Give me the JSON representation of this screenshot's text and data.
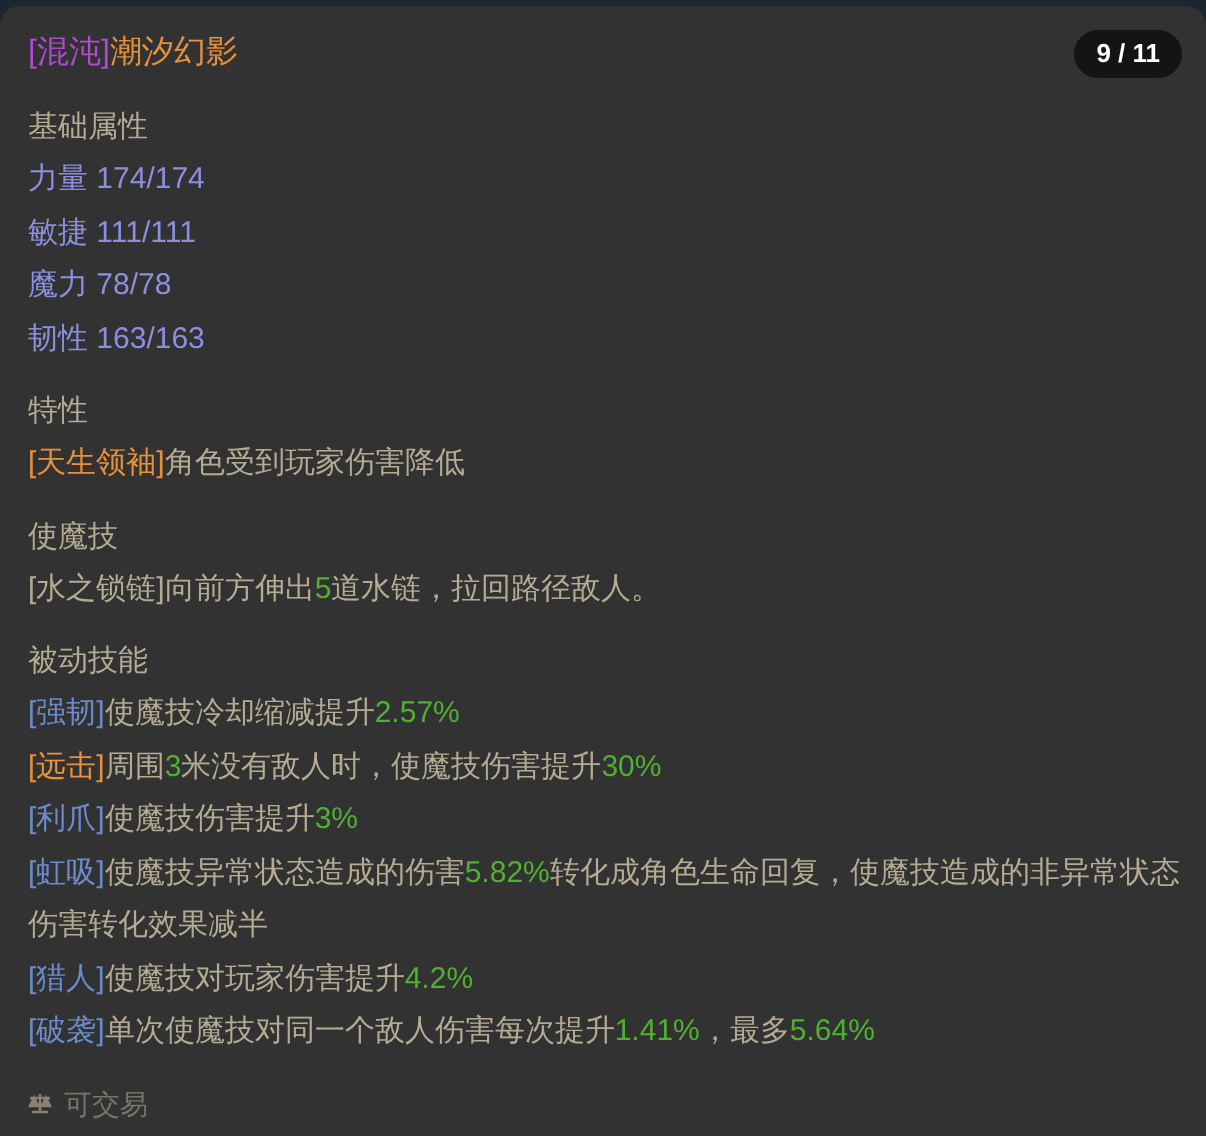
{
  "header": {
    "title": [
      {
        "kind": "chaos",
        "text": "[混沌]"
      },
      {
        "kind": "name",
        "text": "潮汐幻影"
      }
    ],
    "page": "9 / 11"
  },
  "sections": [
    {
      "heading": "基础属性",
      "lines": [
        [
          {
            "kind": "stat",
            "text": "力量 174/174"
          }
        ],
        [
          {
            "kind": "stat",
            "text": "敏捷 111/111"
          }
        ],
        [
          {
            "kind": "stat",
            "text": "魔力 78/78"
          }
        ],
        [
          {
            "kind": "stat",
            "text": "韧性 163/163"
          }
        ]
      ]
    },
    {
      "heading": "特性",
      "lines": [
        [
          {
            "kind": "gold_tag",
            "text": "[天生领袖]"
          },
          {
            "kind": "plain",
            "text": "角色受到玩家伤害降低"
          }
        ]
      ]
    },
    {
      "heading": "使魔技",
      "lines": [
        [
          {
            "kind": "plain",
            "text": "[水之锁链]向前方伸出"
          },
          {
            "kind": "number",
            "text": "5"
          },
          {
            "kind": "plain",
            "text": "道水链，拉回路径敌人。"
          }
        ]
      ]
    },
    {
      "heading": "被动技能",
      "lines": [
        [
          {
            "kind": "blue_tag",
            "text": "[强韧]"
          },
          {
            "kind": "plain",
            "text": "使魔技冷却缩减提升"
          },
          {
            "kind": "number",
            "text": "2.57%"
          }
        ],
        [
          {
            "kind": "gold_tag",
            "text": "[远击]"
          },
          {
            "kind": "plain",
            "text": "周围"
          },
          {
            "kind": "number",
            "text": "3"
          },
          {
            "kind": "plain",
            "text": "米没有敌人时，使魔技伤害提升"
          },
          {
            "kind": "number",
            "text": "30%"
          }
        ],
        [
          {
            "kind": "blue_tag",
            "text": "[利爪]"
          },
          {
            "kind": "plain",
            "text": "使魔技伤害提升"
          },
          {
            "kind": "number",
            "text": "3%"
          }
        ],
        [
          {
            "kind": "blue_tag",
            "text": "[虹吸]"
          },
          {
            "kind": "plain",
            "text": "使魔技异常状态造成的伤害"
          },
          {
            "kind": "number",
            "text": "5.82%"
          },
          {
            "kind": "plain",
            "text": "转化成角色生命回复，使魔技造成的非异常状态伤害转化效果减半"
          }
        ],
        [
          {
            "kind": "blue_tag",
            "text": "[猎人]"
          },
          {
            "kind": "plain",
            "text": "使魔技对玩家伤害提升"
          },
          {
            "kind": "number",
            "text": "4.2%"
          }
        ],
        [
          {
            "kind": "blue_tag",
            "text": "[破袭]"
          },
          {
            "kind": "plain",
            "text": "单次使魔技对同一个敌人伤害每次提升"
          },
          {
            "kind": "number",
            "text": "1.41%"
          },
          {
            "kind": "plain",
            "text": "，最多"
          },
          {
            "kind": "number",
            "text": "5.64%"
          }
        ]
      ]
    }
  ],
  "footer": {
    "label": "可交易"
  }
}
